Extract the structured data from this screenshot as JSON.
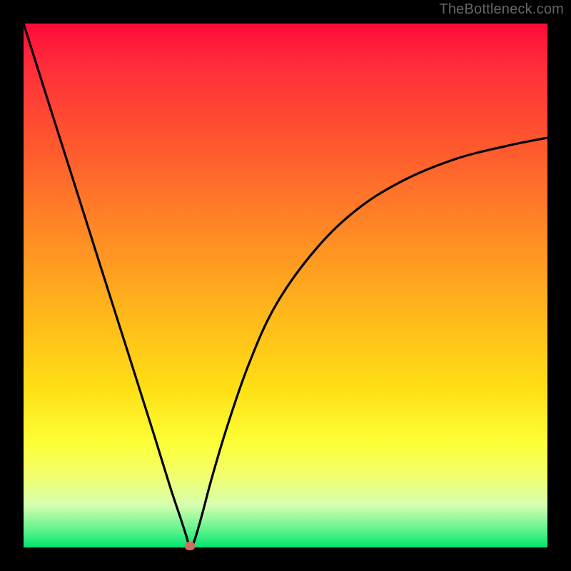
{
  "watermark": "TheBottleneck.com",
  "chart_data": {
    "type": "line",
    "title": "",
    "xlabel": "",
    "ylabel": "",
    "xlim": [
      0,
      1
    ],
    "ylim": [
      0,
      1
    ],
    "grid": false,
    "legend": false,
    "series": [
      {
        "name": "curve",
        "x": [
          0.0,
          0.05,
          0.1,
          0.15,
          0.2,
          0.25,
          0.28,
          0.3,
          0.31,
          0.317,
          0.325,
          0.34,
          0.36,
          0.39,
          0.43,
          0.48,
          0.55,
          0.63,
          0.72,
          0.82,
          0.92,
          1.0
        ],
        "y": [
          1.0,
          0.842,
          0.685,
          0.527,
          0.37,
          0.212,
          0.115,
          0.055,
          0.024,
          0.003,
          0.01,
          0.06,
          0.135,
          0.235,
          0.35,
          0.46,
          0.56,
          0.64,
          0.698,
          0.74,
          0.766,
          0.782
        ]
      }
    ],
    "marker": {
      "x": 0.317,
      "y": 0.003,
      "color": "#d66a5e"
    },
    "gradient_stops": [
      {
        "pos": 0.0,
        "color": "#ff0a3a"
      },
      {
        "pos": 0.24,
        "color": "#ff5a2e"
      },
      {
        "pos": 0.55,
        "color": "#ffb61b"
      },
      {
        "pos": 0.8,
        "color": "#fdff37"
      },
      {
        "pos": 0.97,
        "color": "#55f28a"
      },
      {
        "pos": 1.0,
        "color": "#00e36e"
      }
    ]
  }
}
